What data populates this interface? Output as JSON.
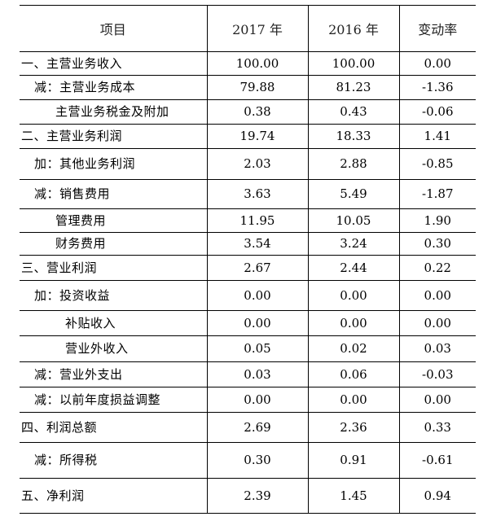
{
  "table": {
    "headers": {
      "item": "项目",
      "y2017": "2017 年",
      "y2016": "2016 年",
      "change": "变动率"
    },
    "rows": [
      {
        "label": "一、主营业务收入",
        "v2017": "100.00",
        "v2016": "100.00",
        "change": "0.00"
      },
      {
        "label": "减：主营业务成本",
        "v2017": "79.88",
        "v2016": "81.23",
        "change": "-1.36"
      },
      {
        "label": "主营业务税金及附加",
        "v2017": "0.38",
        "v2016": "0.43",
        "change": "-0.06"
      },
      {
        "label": "二、主营业务利润",
        "v2017": "19.74",
        "v2016": "18.33",
        "change": "1.41"
      },
      {
        "label": "加：其他业务利润",
        "v2017": "2.03",
        "v2016": "2.88",
        "change": "-0.85"
      },
      {
        "label": "减：销售费用",
        "v2017": "3.63",
        "v2016": "5.49",
        "change": "-1.87"
      },
      {
        "label": "管理费用",
        "v2017": "11.95",
        "v2016": "10.05",
        "change": "1.90"
      },
      {
        "label": "财务费用",
        "v2017": "3.54",
        "v2016": "3.24",
        "change": "0.30"
      },
      {
        "label": "三、营业利润",
        "v2017": "2.67",
        "v2016": "2.44",
        "change": "0.22"
      },
      {
        "label": "加：投资收益",
        "v2017": "0.00",
        "v2016": "0.00",
        "change": "0.00"
      },
      {
        "label": "补贴收入",
        "v2017": "0.00",
        "v2016": "0.00",
        "change": "0.00"
      },
      {
        "label": "营业外收入",
        "v2017": "0.05",
        "v2016": "0.02",
        "change": "0.03"
      },
      {
        "label": "减：营业外支出",
        "v2017": "0.03",
        "v2016": "0.06",
        "change": "-0.03"
      },
      {
        "label": "减：以前年度损益调整",
        "v2017": "0.00",
        "v2016": "0.00",
        "change": "0.00"
      },
      {
        "label": "四、利润总额",
        "v2017": "2.69",
        "v2016": "2.36",
        "change": "0.33"
      },
      {
        "label": "减：所得税",
        "v2017": "0.30",
        "v2016": "0.91",
        "change": "-0.61"
      },
      {
        "label": "五、净利润",
        "v2017": "2.39",
        "v2016": "1.45",
        "change": "0.94"
      }
    ]
  }
}
